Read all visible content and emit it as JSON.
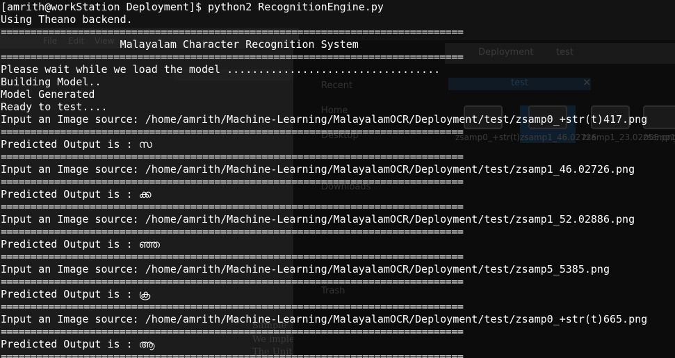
{
  "terminal": {
    "prompt": "[amrith@workStation Deployment]$ python2 RecognitionEngine.py",
    "backend": "Using Theano backend.",
    "separator": "==============================================================================",
    "title": "                   Malayalam Character Recognition System",
    "loading": "Please wait while we load the model ..................................",
    "building": "Building Model..",
    "generated": "Model Generated",
    "ready": "Ready to test....",
    "runs": [
      {
        "input": "Input an Image source: /home/amrith/Machine-Learning/MalayalamOCR/Deployment/test/zsamp0_+str(t)417.png",
        "output": "Predicted Output is : സ"
      },
      {
        "input": "Input an Image source: /home/amrith/Machine-Learning/MalayalamOCR/Deployment/test/zsamp1_46.02726.png",
        "output": "Predicted Output is : ക്ക"
      },
      {
        "input": "Input an Image source: /home/amrith/Machine-Learning/MalayalamOCR/Deployment/test/zsamp1_52.02886.png",
        "output": "Predicted Output is : ഞ്ഞ"
      },
      {
        "input": "Input an Image source: /home/amrith/Machine-Learning/MalayalamOCR/Deployment/test/zsamp5_5385.png",
        "output": "Predicted Output is : ക്ര"
      },
      {
        "input": "Input an Image source: /home/amrith/Machine-Learning/MalayalamOCR/Deployment/test/zsamp0_+str(t)665.png",
        "output": "Predicted Output is : ആ"
      }
    ]
  },
  "background": {
    "menu": [
      "File",
      "Edit",
      "View"
    ],
    "tabs": [
      "Deployment",
      "test"
    ],
    "sidebar": [
      "Recent",
      "Home",
      "Desktop",
      "Downloads",
      "Trash"
    ],
    "selected_folder": "test",
    "files": [
      "zsamp0_+str(t)417",
      "zsamp1_46.02726",
      "zsamp1_23.02055.png",
      "zsamp1_02726"
    ],
    "doc_text": [
      "Sample",
      "We imple",
      "The Unit"
    ]
  },
  "colors": {
    "terminal_bg": "#131313",
    "terminal_fg": "#ffffff"
  }
}
